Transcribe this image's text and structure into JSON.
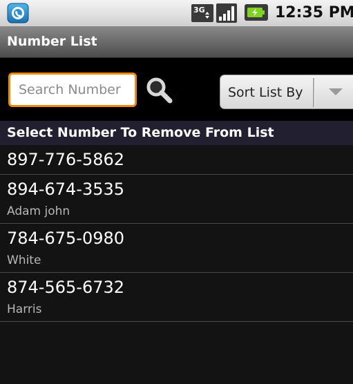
{
  "status_bar": {
    "time": "12:35 PM",
    "network_type": "3G",
    "icons": [
      "app-phone-icon",
      "3g-network-icon",
      "signal-strength-icon",
      "battery-charging-icon"
    ]
  },
  "title_bar": {
    "title": "Number List"
  },
  "toolbar": {
    "search_placeholder": "Search Number",
    "search_value": "",
    "sort_selected": "Sort List By"
  },
  "list": {
    "header": "Select Number To Remove From List",
    "items": [
      {
        "number": "897-776-5862",
        "name": ""
      },
      {
        "number": "894-674-3535",
        "name": "Adam john"
      },
      {
        "number": "784-675-0980",
        "name": "White"
      },
      {
        "number": "874-565-6732",
        "name": "Harris"
      }
    ]
  },
  "colors": {
    "accent_focus": "#f08a0c",
    "list_background": "#131313",
    "header_background": "#222030",
    "title_bar": "#5c5c5c"
  }
}
